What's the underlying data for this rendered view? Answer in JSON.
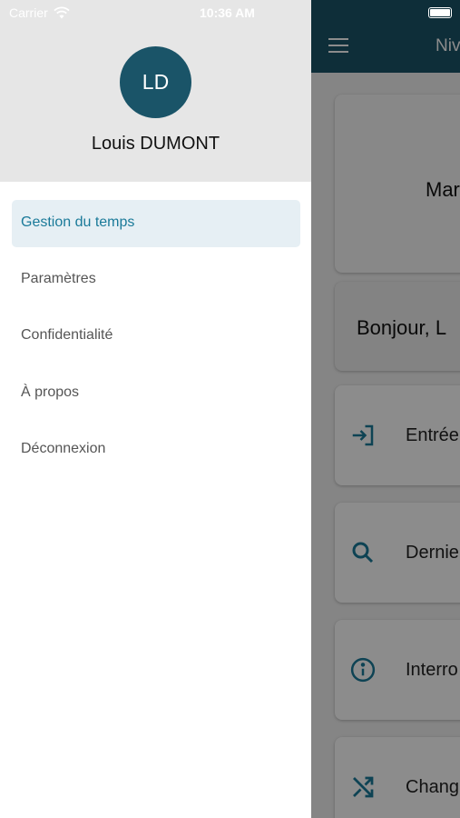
{
  "status_bar": {
    "carrier": "Carrier",
    "time": "10:36 AM"
  },
  "app": {
    "title": "Niv",
    "date_text": "Mar",
    "greeting": "Bonjour,  L",
    "actions": [
      {
        "label": "Entrée",
        "icon": "login-icon"
      },
      {
        "label": "Dernie",
        "icon": "search-icon"
      },
      {
        "label": "Interro",
        "icon": "info-icon"
      },
      {
        "label": "Chang",
        "icon": "shuffle-icon"
      }
    ],
    "accent": "#1a5468"
  },
  "drawer": {
    "avatar_initials": "LD",
    "user_name": "Louis DUMONT",
    "items": [
      {
        "label": "Gestion du temps",
        "active": true
      },
      {
        "label": "Paramètres",
        "active": false
      },
      {
        "label": "Confidentialité",
        "active": false
      },
      {
        "label": "À propos",
        "active": false
      },
      {
        "label": "Déconnexion",
        "active": false
      }
    ],
    "active_color": "#1a7a99",
    "active_bg": "#e6eff4"
  }
}
